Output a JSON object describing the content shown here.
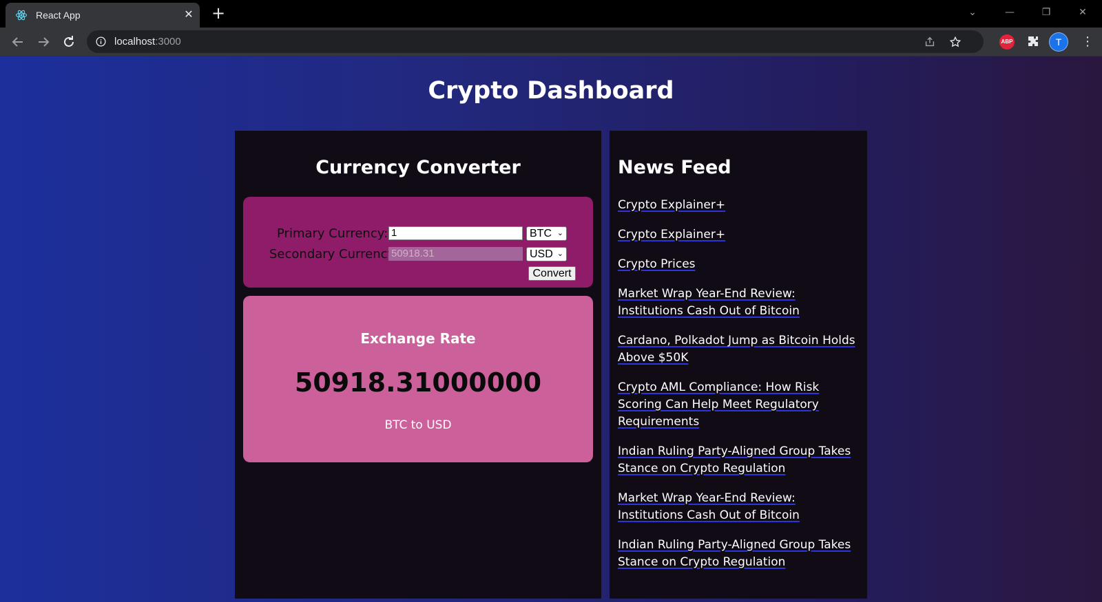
{
  "browser": {
    "tab_title": "React App",
    "url_host": "localhost",
    "url_port": ":3000",
    "avatar_letter": "T",
    "extension_badge": "ABP"
  },
  "page": {
    "title": "Crypto Dashboard"
  },
  "converter": {
    "heading": "Currency Converter",
    "primary_label": "Primary Currency:",
    "primary_value": "1",
    "primary_currency": "BTC",
    "secondary_label": "Secondary Currency:",
    "secondary_value": "50918.31",
    "secondary_currency": "USD",
    "convert_label": "Convert"
  },
  "exchange": {
    "heading": "Exchange Rate",
    "rate": "50918.31000000",
    "pair": "BTC to USD"
  },
  "news": {
    "heading": "News Feed",
    "items": [
      "Crypto Explainer+",
      "Crypto Explainer+",
      "Crypto Prices",
      "Market Wrap Year-End Review: Institutions Cash Out of Bitcoin",
      "Cardano, Polkadot Jump as Bitcoin Holds Above $50K",
      "Crypto AML Compliance: How Risk Scoring Can Help Meet Regulatory Requirements",
      "Indian Ruling Party-Aligned Group Takes Stance on Crypto Regulation",
      "Market Wrap Year-End Review: Institutions Cash Out of Bitcoin",
      "Indian Ruling Party-Aligned Group Takes Stance on Crypto Regulation"
    ]
  },
  "colors": {
    "converter_box": "#8f1c68",
    "rate_box": "#cc609a",
    "panel_bg": "#110b15"
  }
}
